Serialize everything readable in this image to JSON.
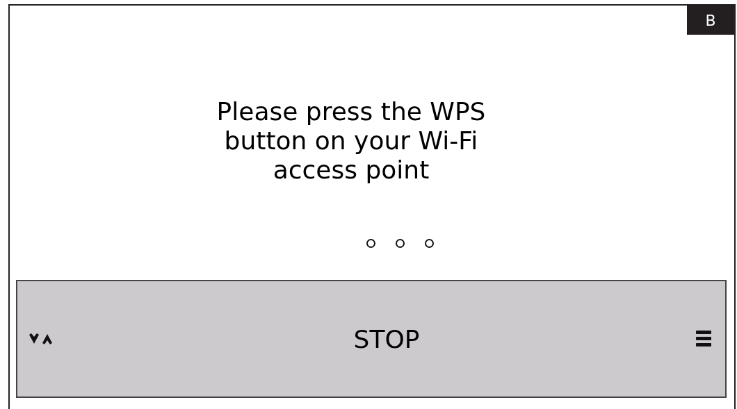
{
  "badge": "B",
  "message": "Please press the WPS\nbutton on your Wi-Fi\naccess point",
  "bottom_bar": {
    "label": "STOP"
  }
}
